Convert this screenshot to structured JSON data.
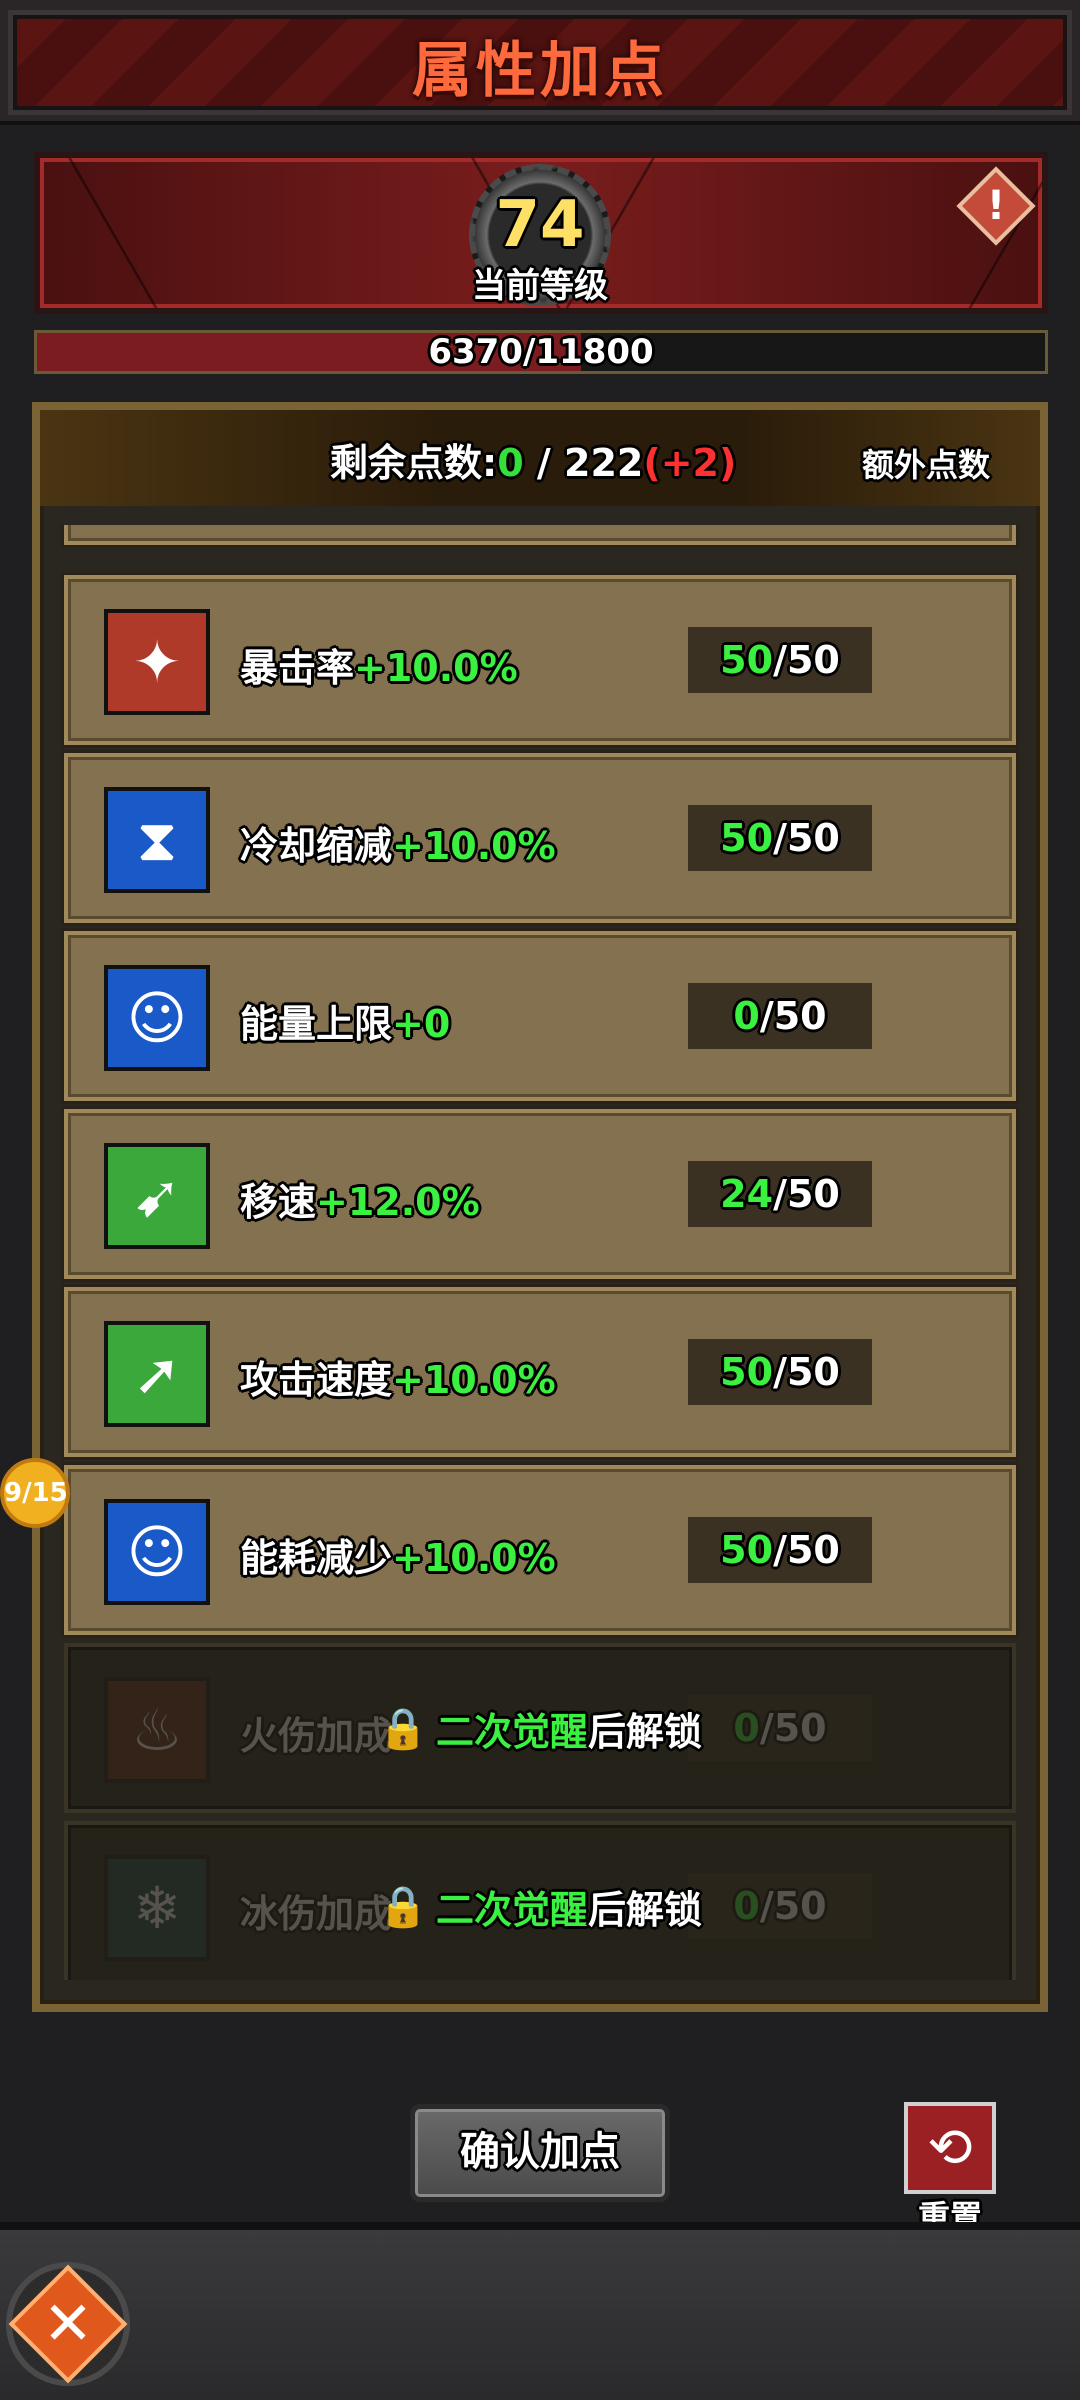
{
  "header": {
    "title": "属性加点"
  },
  "level": {
    "value": "74",
    "label": "当前等级",
    "info_icon": "alert-icon"
  },
  "exp": {
    "text": "6370/11800",
    "current": 6370,
    "max": 11800
  },
  "points": {
    "label": "剩余点数:",
    "current": "0",
    "separator": " / ",
    "total": "222",
    "bonus": "(+2)",
    "extra_label": "额外点数"
  },
  "attributes": [
    {
      "name": "暴击率",
      "bonus": "+10.0%",
      "cur": "50",
      "max": "/50",
      "icon": "crit-icon",
      "color": "#b03a2a",
      "glyph": "✦"
    },
    {
      "name": "冷却缩减",
      "bonus": "+10.0%",
      "cur": "50",
      "max": "/50",
      "icon": "hourglass-icon",
      "color": "#1a5ac8",
      "glyph": "⧗"
    },
    {
      "name": "能量上限",
      "bonus": "+0",
      "cur": "0",
      "max": "/50",
      "icon": "energy-icon",
      "color": "#1a5ac8",
      "glyph": "☺"
    },
    {
      "name": "移速",
      "bonus": "+12.0%",
      "cur": "24",
      "max": "/50",
      "icon": "boot-icon",
      "color": "#3aa83a",
      "glyph": "➹"
    },
    {
      "name": "攻击速度",
      "bonus": "+10.0%",
      "cur": "50",
      "max": "/50",
      "icon": "attack-speed-icon",
      "color": "#3aa83a",
      "glyph": "➚"
    },
    {
      "name": "能耗减少",
      "bonus": "+10.0%",
      "cur": "50",
      "max": "/50",
      "icon": "energy-cost-icon",
      "color": "#1a5ac8",
      "glyph": "☺"
    }
  ],
  "locked": [
    {
      "name": "火伤加成",
      "cur": "0",
      "max": "/50",
      "icon": "fire-icon",
      "color": "#6a2a1a",
      "glyph": "♨",
      "unlock_highlight": "二次觉醒",
      "unlock_suffix": "后解锁"
    },
    {
      "name": "冰伤加成",
      "cur": "0",
      "max": "/50",
      "icon": "ice-icon",
      "color": "#1a4a4a",
      "glyph": "❄",
      "unlock_highlight": "二次觉醒",
      "unlock_suffix": "后解锁"
    }
  ],
  "side_badge": "9/15",
  "confirm_label": "确认加点",
  "reset_label": "重置"
}
